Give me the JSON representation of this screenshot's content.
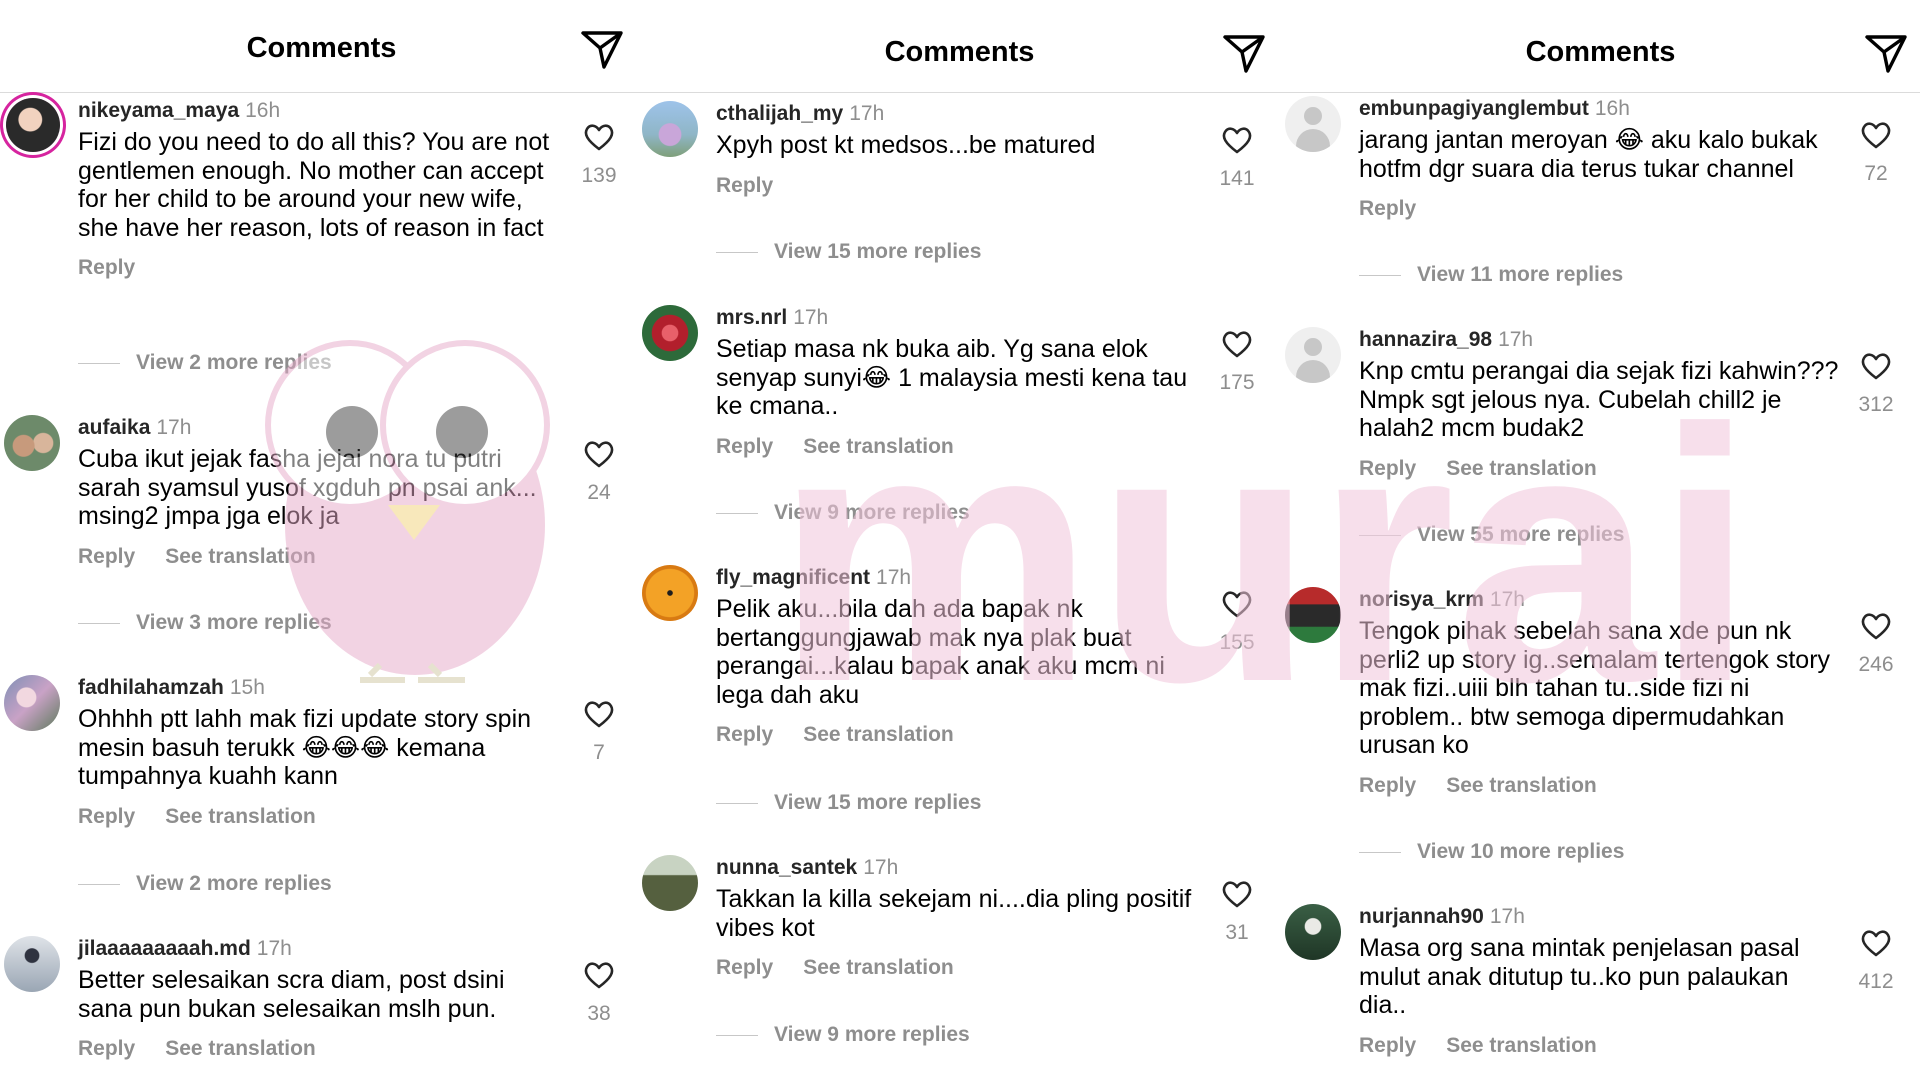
{
  "panels": [
    {
      "title": "Comments",
      "comments": [
        {
          "user": "nikeyama_maya",
          "time": "16h",
          "text": "Fizi do you need to do all this? You are not gentlemen enough. No mother can accept for her child to be around your new wife, she have her reason, lots of reason in fact",
          "likes": "139",
          "reply": "Reply",
          "translate": "",
          "more": "View 2 more replies"
        },
        {
          "user": "aufaika",
          "time": "17h",
          "text": "Cuba ikut jejak fasha jejai nora tu putri sarah syamsul yusof xgduh pn psai ank... msing2 jmpa jga elok ja",
          "likes": "24",
          "reply": "Reply",
          "translate": "See translation",
          "more": "View 3 more replies"
        },
        {
          "user": "fadhilahamzah",
          "time": "15h",
          "text": "Ohhhh ptt lahh mak fizi update story spin mesin basuh terukk 😂😂😂 kemana tumpahnya kuahh kann",
          "likes": "7",
          "reply": "Reply",
          "translate": "See translation",
          "more": "View 2 more replies"
        },
        {
          "user": "jilaaaaaaaaah.md",
          "time": "17h",
          "text": "Better selesaikan scra diam, post dsini sana pun bukan selesaikan mslh pun.",
          "likes": "38",
          "reply": "Reply",
          "translate": "See translation",
          "more": ""
        }
      ]
    },
    {
      "title": "Comments",
      "comments": [
        {
          "user": "cthalijah_my",
          "time": "17h",
          "text": "Xpyh post kt medsos...be matured",
          "likes": "141",
          "reply": "Reply",
          "translate": "",
          "more": "View 15 more replies"
        },
        {
          "user": "mrs.nrl",
          "time": "17h",
          "text": "Setiap masa nk buka aib. Yg sana elok senyap sunyi😂 1 malaysia mesti kena tau ke cmana..",
          "likes": "175",
          "reply": "Reply",
          "translate": "See translation",
          "more": "View 9 more replies"
        },
        {
          "user": "fly_magnificent",
          "time": "17h",
          "text": "Pelik aku...bila dah ada bapak nk bertanggungjawab mak nya plak buat perangai...kalau bapak anak aku mcm ni lega dah aku",
          "likes": "155",
          "reply": "Reply",
          "translate": "See translation",
          "more": "View 15 more replies"
        },
        {
          "user": "nunna_santek",
          "time": "17h",
          "text": "Takkan la killa sekejam ni....dia pling positif vibes kot",
          "likes": "31",
          "reply": "Reply",
          "translate": "See translation",
          "more": "View 9 more replies"
        }
      ]
    },
    {
      "title": "Comments",
      "comments": [
        {
          "user": "embunpagiyanglembut",
          "time": "16h",
          "text": "jarang jantan meroyan 😂 aku kalo bukak hotfm dgr suara dia terus tukar channel",
          "likes": "72",
          "reply": "Reply",
          "translate": "",
          "more": "View 11 more replies"
        },
        {
          "user": "hannazira_98",
          "time": "17h",
          "text": "Knp cmtu perangai dia sejak fizi kahwin??? Nmpk sgt jelous nya. Cubelah chill2 je halah2 mcm budak2",
          "likes": "312",
          "reply": "Reply",
          "translate": "See translation",
          "more": "View 55 more replies"
        },
        {
          "user": "norisya_krm",
          "time": "17h",
          "text": "Tengok pihak sebelah sana xde pun nk perli2 up story ig..semalam tertengok story mak fizi..uiii blh tahan tu..side fizi ni problem.. btw semoga dipermudahkan urusan ko",
          "likes": "246",
          "reply": "Reply",
          "translate": "See translation",
          "more": "View 10 more replies"
        },
        {
          "user": "nurjannah90",
          "time": "17h",
          "text": "Masa org sana mintak penjelasan pasal mulut anak ditutup tu..ko pun palaukan dia..",
          "likes": "412",
          "reply": "Reply",
          "translate": "See translation",
          "more": ""
        }
      ]
    }
  ],
  "watermark": "murai",
  "icons": {
    "send": "paper-plane-icon",
    "like": "heart-icon"
  },
  "colors": {
    "secondary_text": "#8e8e8e",
    "divider": "#dbdbdb",
    "watermark": "#f2c6db"
  }
}
